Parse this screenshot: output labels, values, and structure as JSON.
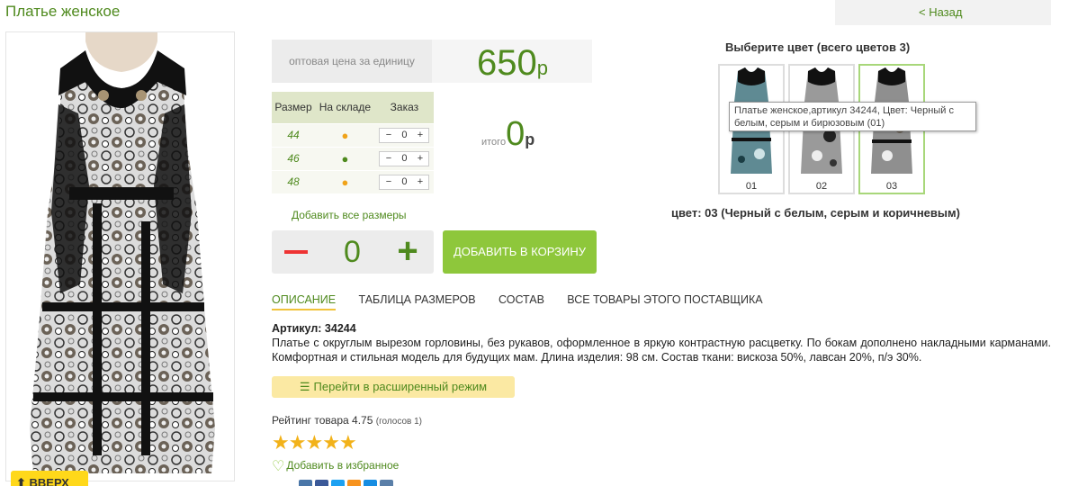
{
  "page": {
    "title": "Платье женское",
    "back_label": "< Назад"
  },
  "price": {
    "label": "оптовая цена за единицу",
    "value": "650",
    "currency": "р"
  },
  "size_table": {
    "headers": [
      "Размер",
      "На складе",
      "Заказ"
    ],
    "rows": [
      {
        "size": "44",
        "stock_icon": "dot-orange",
        "qty": "0"
      },
      {
        "size": "46",
        "stock_icon": "dot-green",
        "qty": "0"
      },
      {
        "size": "48",
        "stock_icon": "dot-orange",
        "qty": "0"
      }
    ]
  },
  "total": {
    "label": "итого",
    "value": "0",
    "currency": "р"
  },
  "add_all_label": "Добавить все размеры",
  "quantity": {
    "value": "0",
    "minus": "−",
    "plus": "+"
  },
  "add_to_cart_label": "ДОБАВИТЬ В КОРЗИНУ",
  "tabs": [
    {
      "label": "ОПИСАНИЕ",
      "active": true
    },
    {
      "label": "ТАБЛИЦА РАЗМЕРОВ"
    },
    {
      "label": "СОСТАВ"
    },
    {
      "label": "ВСЕ ТОВАРЫ ЭТОГО ПОСТАВЩИКА"
    }
  ],
  "description": {
    "article": "Артикул: 34244",
    "text": "Платье с округлым вырезом горловины, без рукавов, оформленное в яркую контрастную расцветку. По бокам дополнено накладными карманами. Комфортная и стильная модель для будущих мам. Длина изделия: 98 см. Состав ткани: вискоза 50%, лавсан 20%, п/э 30%."
  },
  "advanced_mode_label": "Перейти в расширенный режим",
  "rating": {
    "label": "Рейтинг товара 4.75",
    "votes": "(голосов 1)",
    "value": 4.75
  },
  "favorite_label": "Добавить в избранное",
  "up_label": "⬆ ВВЕРХ",
  "colors": {
    "title": "Выберите цвет (всего цветов 3)",
    "swatches": [
      {
        "label": "01"
      },
      {
        "label": "02"
      },
      {
        "label": "03",
        "selected": true
      }
    ],
    "selected_text": "цвет: 03 (Черный с белым, серым и коричневым)",
    "tooltip": "Платье женское,артикул 34244, Цвет: Черный с белым, серым и бирюзовым (01)"
  },
  "theme": {
    "accent": "#4f8a1e",
    "button_green": "#8ec73b",
    "highlight": "#fbe9a3",
    "star": "#f2b21a"
  }
}
